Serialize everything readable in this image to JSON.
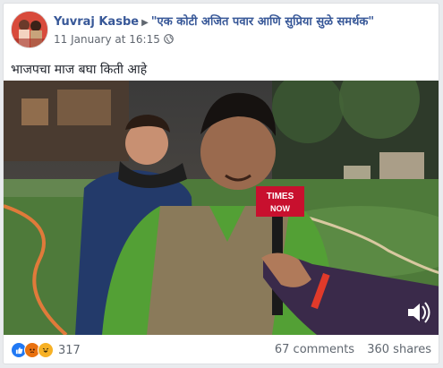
{
  "post": {
    "author": "Yuvraj Kasbe",
    "target": "\"एक कोटी अजित पवार आणि सुप्रिया सुळे समर्थक\"",
    "date": "11 January at 16:15",
    "text": "भाजपचा माज बघा किती आहे"
  },
  "video": {
    "mic_label_top": "TIMES",
    "mic_label_bottom": "NOW",
    "volume_icon": "volume-icon"
  },
  "footer": {
    "reaction_count": "317",
    "comments": "67 comments",
    "shares": "360 shares",
    "reactions": [
      "like-icon",
      "angry-icon",
      "haha-icon"
    ]
  },
  "colors": {
    "link": "#385898",
    "like": "#2078f4",
    "angry": "#e9710f",
    "haha": "#f7b125"
  }
}
